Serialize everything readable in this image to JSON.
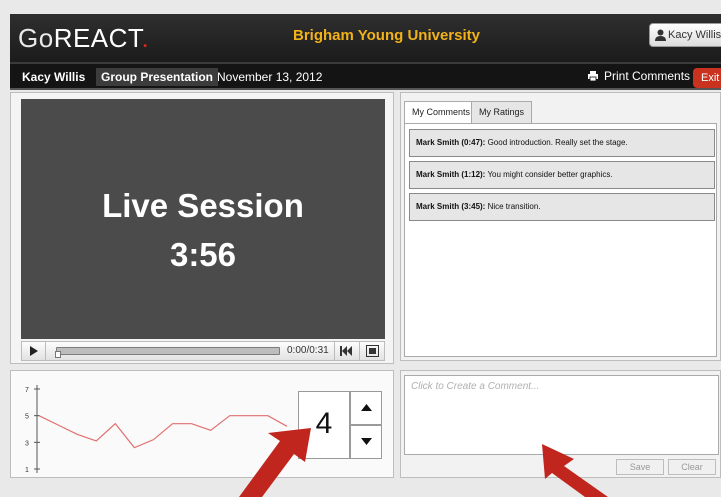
{
  "header": {
    "logo_go": "Go",
    "logo_react": "REACT",
    "logo_dot": ".",
    "university": "Brigham Young University",
    "user_label": "Kacy Willis",
    "user_caret": "▾"
  },
  "subheader": {
    "student": "Kacy Willis",
    "assignment": "Group Presentation",
    "date": "November 13, 2012",
    "print_label": "Print Comments",
    "exit_label": "Exit"
  },
  "video": {
    "title": "Live Session",
    "elapsed": "3:56",
    "time_display": "0:00/0:31",
    "progress_fraction": 0
  },
  "tabs": [
    {
      "label": "My Comments",
      "active": true
    },
    {
      "label": "My Ratings",
      "active": false
    }
  ],
  "comments": [
    {
      "author": "Mark Smith (0:47):",
      "text": " Good introduction. Really set the stage."
    },
    {
      "author": "Mark Smith (1:12):",
      "text": " You might consider better graphics."
    },
    {
      "author": "Mark Smith (3:45):",
      "text": " Nice transition."
    }
  ],
  "comment_input": {
    "value": "",
    "placeholder": "Click to Create a Comment..."
  },
  "buttons": {
    "save": "Save",
    "clear": "Clear"
  },
  "rating": {
    "current": "4",
    "chart_data": {
      "type": "line",
      "y_ticks": [
        "7",
        "5",
        "3",
        "1"
      ],
      "ylim": [
        1,
        7
      ],
      "values": [
        5,
        4.3,
        3.6,
        3.1,
        4.4,
        2.6,
        3.2,
        4.4,
        4.4,
        3.9,
        5,
        5,
        5,
        4.2
      ],
      "color": "#e07070"
    }
  },
  "colors": {
    "accent_gold": "#f2b21a",
    "exit_red": "#c8321f",
    "arrow_red": "#c0261e"
  }
}
